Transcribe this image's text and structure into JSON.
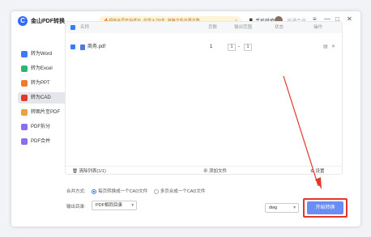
{
  "titlebar": {
    "logo_char": "C",
    "title": "金山PDF转换",
    "promo": "🔥超级会员年中低价, 仅需￥29/年, 转换文件不限次数",
    "promo_close": "×",
    "phone": "手机转换",
    "vip": "开通会员",
    "menu": "≡",
    "minimize": "—",
    "maximize": "□",
    "close": "✕"
  },
  "sidebar": {
    "items": [
      {
        "label": "转为Word",
        "color": "#3a7afe"
      },
      {
        "label": "转为Excel",
        "color": "#2bb673"
      },
      {
        "label": "转为PPT",
        "color": "#f07a2a"
      },
      {
        "label": "转为CAD",
        "color": "#e0392b"
      },
      {
        "label": "转图片至PDF",
        "color": "#e9a23b"
      },
      {
        "label": "PDF拆分",
        "color": "#8a6df0"
      },
      {
        "label": "PDF合并",
        "color": "#8a6df0"
      }
    ],
    "active_index": 3
  },
  "table": {
    "headers": [
      "名称",
      "页数",
      "输出范围",
      "状态",
      "操作"
    ],
    "rows": [
      {
        "name": "商务.pdf",
        "pages": "1",
        "range_from": "1",
        "range_sep": "-",
        "range_to": "1",
        "status": ""
      }
    ]
  },
  "footer": {
    "delete": "清除列表(1/1)",
    "add": "添加文件",
    "settings": "设置"
  },
  "options": {
    "merge_label": "合并方式:",
    "opt1": "每页转换成一个CAD文件",
    "opt2": "多页合成一个CAD文件",
    "output_label": "输出目录:",
    "output_value": "PDF相同目录",
    "format_value": "dwg",
    "start": "开始转换"
  },
  "colors": {
    "accent": "#3a7afe",
    "highlight": "#e0392b"
  }
}
